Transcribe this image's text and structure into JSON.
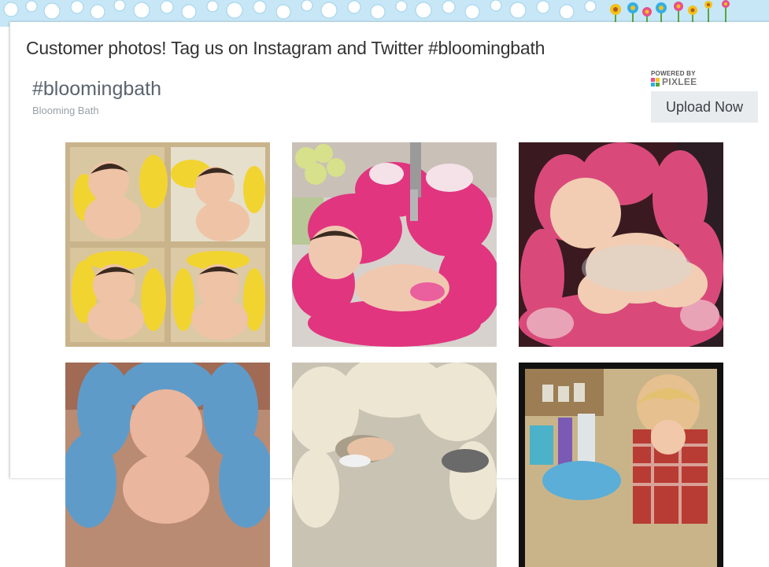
{
  "header": {
    "title": "Customer photos! Tag us on Instagram and Twitter #bloomingbath"
  },
  "gallery": {
    "hashtag": "#bloomingbath",
    "subtitle": "Blooming Bath",
    "powered_by": "POWERED BY",
    "brand": "PIXLEE",
    "upload_label": "Upload Now"
  },
  "photos": [
    {
      "description_icon": "baby-collage-yellow-flower-photo"
    },
    {
      "description_icon": "baby-pink-flower-sink-photo"
    },
    {
      "description_icon": "baby-pink-flower-bath-photo"
    },
    {
      "description_icon": "baby-blue-flower-photo"
    },
    {
      "description_icon": "cream-flower-bath-photo"
    },
    {
      "description_icon": "toddler-sink-photo"
    }
  ],
  "colors": {
    "accent_pink": "#e0337a",
    "button_bg": "#e9ecef",
    "title": "#333333"
  }
}
